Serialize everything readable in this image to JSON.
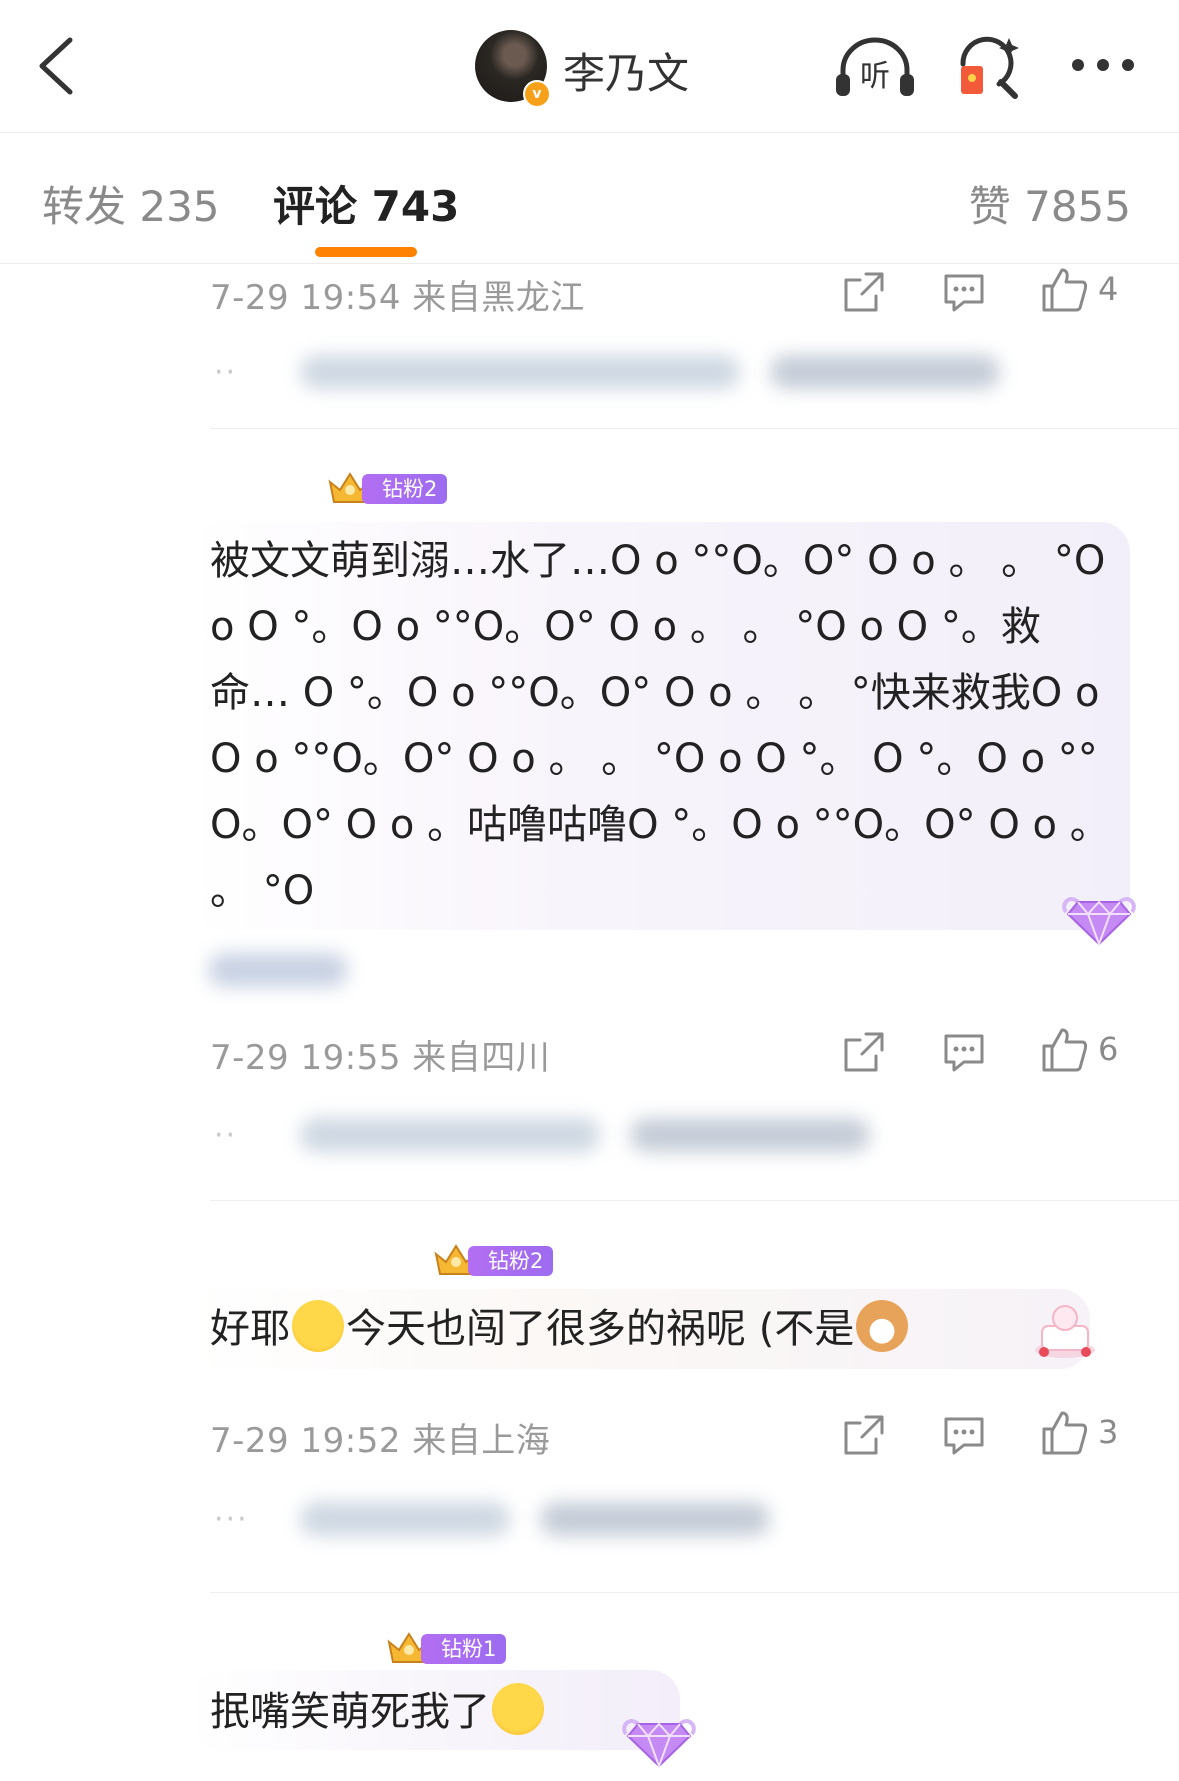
{
  "nav": {
    "title": "李乃文",
    "listen_label": "听"
  },
  "tabs": {
    "repost": "转发 235",
    "comment": "评论 743",
    "like": "赞 7855"
  },
  "comments": [
    {
      "meta": "7-29 19:54 来自黑龙江",
      "likes": "4"
    },
    {
      "badge": "钻粉2",
      "text": "被文文萌到溺…水了…O o °°O。O° O o 。 。 °O o O °。O o °°O。O° O o 。 。 °O o O °。救命… O °。O o °°O。O° O o 。 。 °快来救我O o O o °°O。O° O o 。 。 °O o O °。 O °。O o °°O。O° O o 。咕噜咕噜O °。O o °°O。O° O o 。 。 °O",
      "meta": "7-29 19:55 来自四川",
      "likes": "6"
    },
    {
      "badge": "钻粉2",
      "text_a": "好耶",
      "text_b": "今天也闯了很多的祸呢 (不是",
      "meta": "7-29 19:52 来自上海",
      "likes": "3"
    },
    {
      "badge": "钻粉1",
      "text": "抿嘴笑萌死我了"
    }
  ],
  "colors": {
    "accent": "#ff8200",
    "badge_purple": "#a66ef2",
    "meta_gray": "#9a9a9a"
  }
}
